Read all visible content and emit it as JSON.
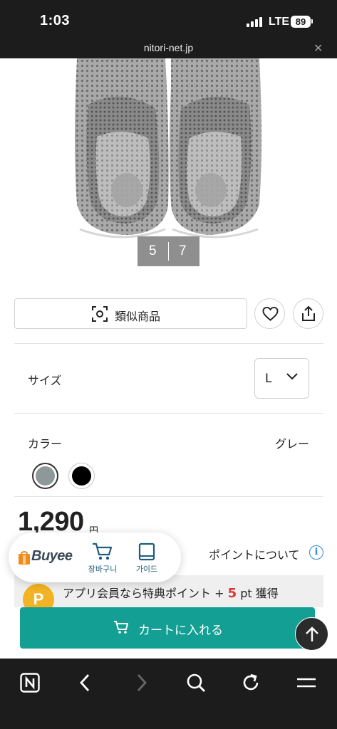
{
  "status_bar": {
    "time": "1:03",
    "network": "LTE",
    "battery": "89"
  },
  "browser": {
    "url": "nitori-net.jp"
  },
  "gallery": {
    "current": "5",
    "total": "7"
  },
  "product": {
    "similar_button": "類似商品",
    "size_label": "サイズ",
    "size_value": "L",
    "color_label": "カラー",
    "color_value": "グレー",
    "color_swatches": [
      "#8f9898",
      "#000000"
    ],
    "price": "1,290",
    "price_unit": "円",
    "points_link": "ポイントについて",
    "points_banner": {
      "coin_letter": "P",
      "prefix": "アプリ会員なら特典ポイント + ",
      "points": "5",
      "suffix": " pt 獲得"
    },
    "add_to_cart": "カートに入れる"
  },
  "buyee": {
    "logo": "Buyee",
    "cart_label": "장바구니",
    "guide_label": "가이드"
  },
  "colors": {
    "accent": "#139f93",
    "buyee_orange": "#f08c1a",
    "points_red": "#d9383a",
    "coin": "#f2b324",
    "chrome": "#1c1c1c"
  },
  "toolbar": {
    "icons": [
      "naver-icon",
      "back-icon",
      "forward-icon",
      "search-icon",
      "refresh-icon",
      "menu-icon"
    ]
  }
}
